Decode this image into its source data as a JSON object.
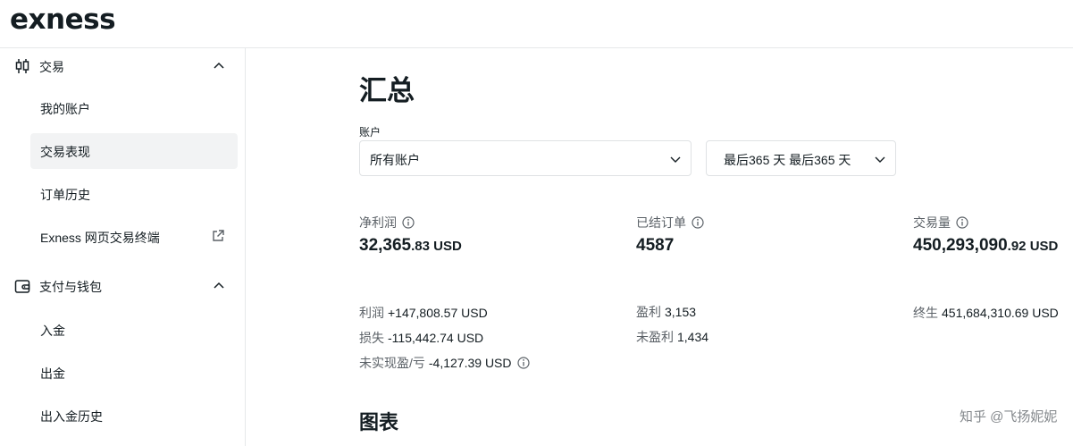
{
  "brand": {
    "logo_text": "exness"
  },
  "sidebar": {
    "groups": [
      {
        "label": "交易",
        "icon": "candlestick-icon",
        "items": [
          {
            "label": "我的账户"
          },
          {
            "label": "交易表现",
            "active": true
          },
          {
            "label": "订单历史"
          },
          {
            "label": "Exness 网页交易终端",
            "icon": "external-link-icon"
          }
        ]
      },
      {
        "label": "支付与钱包",
        "icon": "wallet-icon",
        "items": [
          {
            "label": "入金"
          },
          {
            "label": "出金"
          },
          {
            "label": "出入金历史"
          }
        ]
      }
    ]
  },
  "main": {
    "title": "汇总",
    "account_label": "账户",
    "account_select": "所有账户",
    "period_select": "最后365 天 最后365 天",
    "metrics": [
      {
        "title": "净利润",
        "value_main": "32,365",
        "value_decimal": ".83",
        "value_unit": " USD",
        "details": [
          {
            "label": "利润",
            "value": "+147,808.57 USD"
          },
          {
            "label": "损失",
            "value": "-115,442.74 USD"
          },
          {
            "label": "未实现盈/亏",
            "value": "-4,127.39 USD"
          }
        ]
      },
      {
        "title": "已结订单",
        "value_main": "4587",
        "details": [
          {
            "label": "盈利",
            "value": "3,153"
          },
          {
            "label": "未盈利",
            "value": "1,434"
          }
        ]
      },
      {
        "title": "交易量",
        "value_main": "450,293,090",
        "value_decimal": ".92",
        "value_unit": " USD",
        "details": [
          {
            "label": "终生",
            "value": "451,684,310.69 USD"
          }
        ]
      }
    ],
    "chart_section_title": "图表"
  },
  "watermark": "知乎 @飞扬妮妮",
  "colors": {
    "text": "#141d22",
    "muted": "#5b6167",
    "border": "#dfe2e4",
    "active_bg": "#f2f3f4"
  }
}
